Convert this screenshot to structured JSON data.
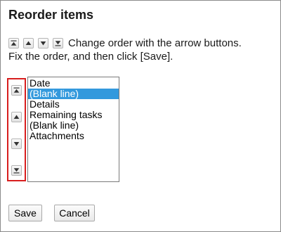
{
  "dialog": {
    "title": "Reorder items",
    "instruction_line1": "Change order with the arrow buttons.",
    "instruction_line2": "Fix the order, and then click [Save]."
  },
  "instruction_icons": [
    "move-to-top-icon",
    "move-up-icon",
    "move-down-icon",
    "move-to-bottom-icon"
  ],
  "arrow_buttons": [
    {
      "name": "move-to-top-button",
      "icon": "move-to-top-icon"
    },
    {
      "name": "move-up-button",
      "icon": "move-up-icon"
    },
    {
      "name": "move-down-button",
      "icon": "move-down-icon"
    },
    {
      "name": "move-to-bottom-button",
      "icon": "move-to-bottom-icon"
    }
  ],
  "items": [
    {
      "label": "Date",
      "selected": false
    },
    {
      "label": "(Blank line)",
      "selected": true
    },
    {
      "label": "Details",
      "selected": false
    },
    {
      "label": "Remaining tasks",
      "selected": false
    },
    {
      "label": "(Blank line)",
      "selected": false
    },
    {
      "label": "Attachments",
      "selected": false
    }
  ],
  "buttons": {
    "save_label": "Save",
    "cancel_label": "Cancel"
  },
  "colors": {
    "highlight_border": "#d81e1e",
    "selection": "#3399dd"
  }
}
